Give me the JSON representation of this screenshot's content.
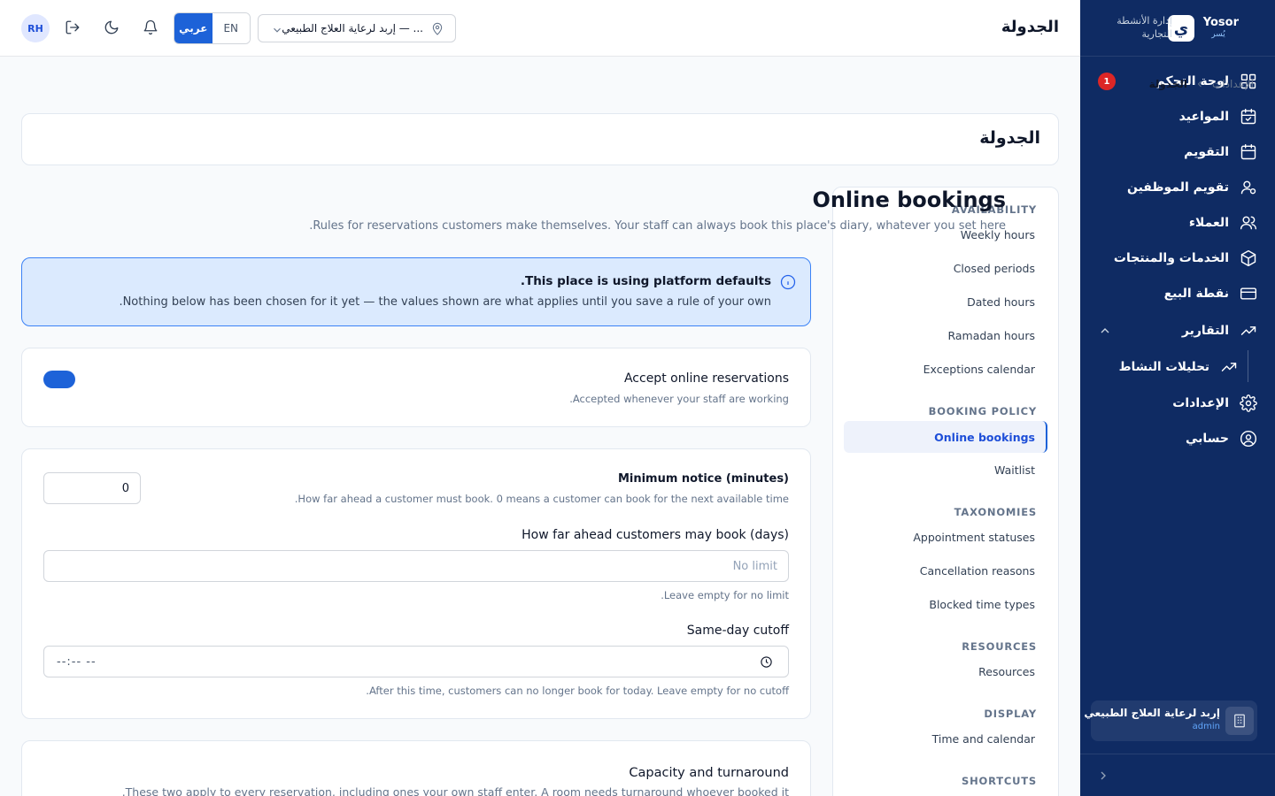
{
  "brand": {
    "name": "Yosor",
    "sub": "يُسر",
    "logo_char": "ي",
    "description": "إدارة الأنشطة التجارية"
  },
  "header": {
    "title": "الجدولة",
    "branch": "إربد لرعاية العلاج الطبيعي — ...",
    "lang_ar": "عربي",
    "lang_en": "EN",
    "avatar": "RH"
  },
  "nav": {
    "dashboard": {
      "label": "لوحة التحكم",
      "badge": "1"
    },
    "appointments": "المواعيد",
    "calendar": "التقويم",
    "staff_calendar": "تقويم الموظفين",
    "clients": "العملاء",
    "services": "الخدمات والمنتجات",
    "pos": "نقطة البيع",
    "reports": "التقارير",
    "activity": "تحليلات النشاط",
    "settings": "الإعدادات",
    "account": "حسابي"
  },
  "account": {
    "name": "إربد لرعاية العلاج الطبيعي",
    "role": "admin"
  },
  "breadcrumb": {
    "parent": "الإعدادات",
    "current": "الجدولة"
  },
  "page_title": "الجدولة",
  "settings_nav": {
    "availability": {
      "heading": "AVAILABILITY",
      "items": [
        "Weekly hours",
        "Closed periods",
        "Dated hours",
        "Ramadan hours",
        "Exceptions calendar"
      ]
    },
    "booking_policy": {
      "heading": "BOOKING POLICY",
      "items": [
        "Online bookings",
        "Waitlist"
      ]
    },
    "taxonomies": {
      "heading": "TAXONOMIES",
      "items": [
        "Appointment statuses",
        "Cancellation reasons",
        "Blocked time types"
      ]
    },
    "resources": {
      "heading": "RESOURCES",
      "items": [
        "Resources"
      ]
    },
    "display": {
      "heading": "DISPLAY",
      "items": [
        "Time and calendar"
      ]
    },
    "shortcuts": {
      "heading": "SHORTCUTS"
    }
  },
  "section": {
    "title": "Online bookings",
    "description": ".Rules for reservations customers make themselves. Your staff can always book this place's diary, whatever you set here"
  },
  "info": {
    "title": ".This place is using platform defaults",
    "body": ".Nothing below has been chosen for it yet — the values shown are what applies until you save a rule of your own"
  },
  "accept_online": {
    "label": "Accept online reservations",
    "hint": ".Accepted whenever your staff are working",
    "enabled": true
  },
  "min_notice": {
    "label": "Minimum notice (minutes)",
    "hint": ".How far ahead a customer must book. 0 means a customer can book for the next available time",
    "value": "0"
  },
  "max_ahead": {
    "label": "How far ahead customers may book (days)",
    "placeholder": "No limit",
    "hint": ".Leave empty for no limit"
  },
  "cutoff": {
    "label": "Same-day cutoff",
    "value": "--:-- --",
    "hint": ".After this time, customers can no longer book for today. Leave empty for no cutoff"
  },
  "capacity": {
    "title": "Capacity and turnaround",
    "description": ".These two apply to every reservation, including ones your own staff enter. A room needs turnaround whoever booked it"
  },
  "colors": {
    "sidebar": "#0f2b63",
    "accent": "#1d62d8",
    "info_bg": "#dbeafe",
    "badge": "#dc2626"
  }
}
